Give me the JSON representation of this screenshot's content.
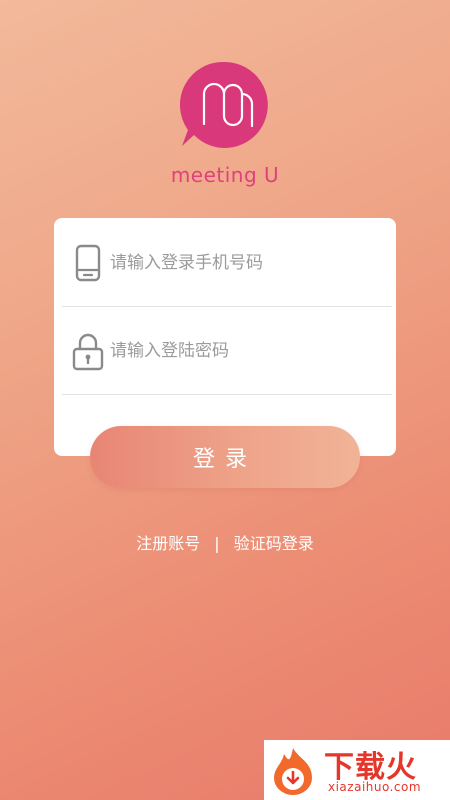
{
  "app": {
    "name": "meeting U",
    "logo_icon": "mu-bubble-logo-icon",
    "brand_color": "#e0417c"
  },
  "login_form": {
    "phone_placeholder": "请输入登录手机号码",
    "phone_icon": "mobile-phone-icon",
    "password_placeholder": "请输入登陆密码",
    "password_icon": "padlock-icon",
    "submit_label": "登录"
  },
  "links": {
    "register_label": "注册账号",
    "separator": "|",
    "sms_login_label": "验证码登录"
  },
  "watermark": {
    "title": "下载火",
    "url": "xiazaihuo.com",
    "color": "#e5362b"
  }
}
